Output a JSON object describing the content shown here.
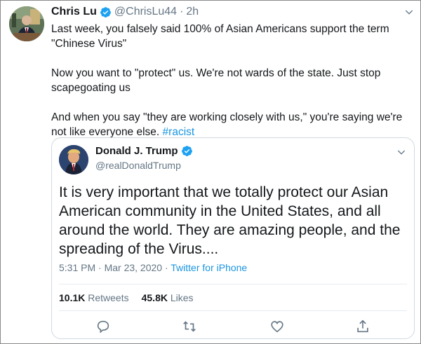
{
  "outer_tweet": {
    "author_name": "Chris Lu",
    "handle": "@ChrisLu44",
    "separator": "·",
    "time": "2h",
    "paragraphs": [
      "Last week, you falsely said 100% of Asian Americans support the term \"Chinese Virus\"",
      "Now you want to \"protect\" us. We're not wards of the state. Just stop scapegoating us",
      "And when you say \"they are working closely with us,\" you're saying we're not like everyone else. "
    ],
    "hashtag": "#racist"
  },
  "quoted_tweet": {
    "author_name": "Donald J. Trump",
    "handle": "@realDonaldTrump",
    "text": "It is very important that we totally protect our Asian American community in the United States, and all around the world. They are amazing people, and the spreading of the Virus....",
    "timestamp": "5:31 PM · Mar 23, 2020",
    "meta_separator": " · ",
    "source": "Twitter for iPhone",
    "retweets_count": "10.1K",
    "retweets_label": "Retweets",
    "likes_count": "45.8K",
    "likes_label": "Likes"
  },
  "icons": {
    "verified": "verified-badge-icon",
    "more": "chevron-down-icon",
    "reply": "reply-icon",
    "retweet": "retweet-icon",
    "like": "heart-icon",
    "share": "share-icon"
  },
  "colors": {
    "accent": "#1b95e0",
    "verified": "#1da1f2",
    "secondary_text": "#657786",
    "primary_text": "#14171a",
    "border": "#cfd9de"
  }
}
